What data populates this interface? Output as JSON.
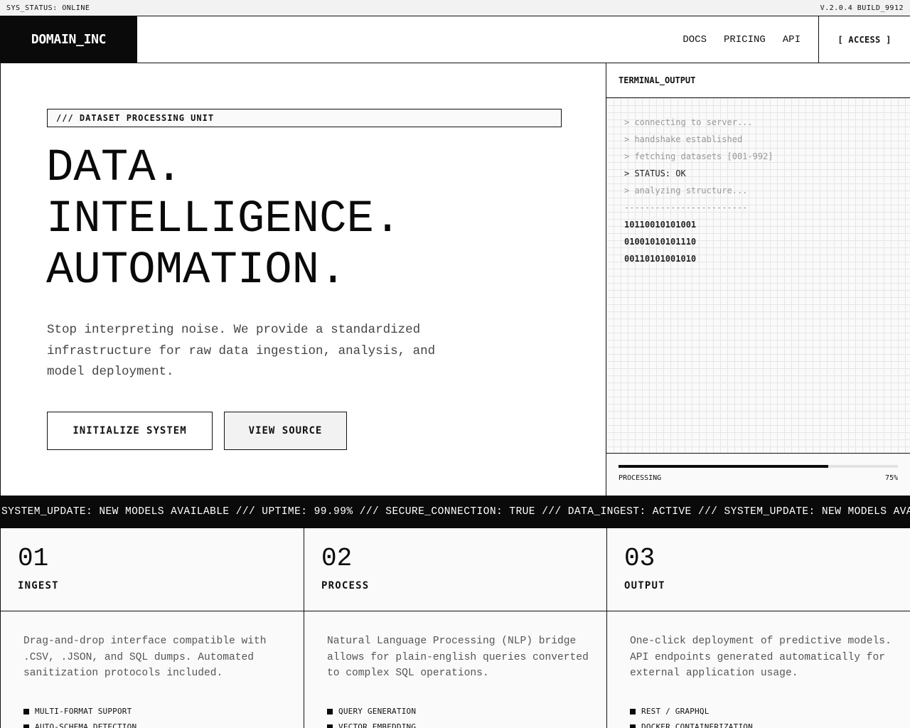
{
  "status_bar": {
    "left": "SYS_STATUS: ONLINE",
    "right": "V.2.0.4 BUILD_9912"
  },
  "header": {
    "logo": "DOMAIN_INC",
    "nav": [
      "DOCS",
      "PRICING",
      "API"
    ],
    "access_label": "[ ACCESS ]"
  },
  "hero": {
    "eyebrow": "/// DATASET PROCESSING UNIT",
    "headline": [
      "DATA.",
      "INTELLIGENCE.",
      "AUTOMATION."
    ],
    "lead": "Stop interpreting noise. We provide a standardized infrastructure for raw data ingestion, analysis, and model deployment.",
    "primary_button": "INITIALIZE SYSTEM",
    "secondary_button": "VIEW SOURCE"
  },
  "terminal": {
    "title": "TERMINAL_OUTPUT",
    "lines": [
      {
        "text": "> connecting to server...",
        "style": "dim"
      },
      {
        "text": "> handshake established",
        "style": "dim"
      },
      {
        "text": "> fetching datasets [001-992]",
        "style": "dim"
      },
      {
        "text": "> STATUS: OK",
        "style": "ok"
      },
      {
        "text": "> analyzing structure...",
        "style": "dim"
      },
      {
        "text": "------------------------",
        "style": "dim"
      },
      {
        "text": "10110010101001",
        "style": "bin"
      },
      {
        "text": "01001010101110",
        "style": "bin"
      },
      {
        "text": "00110101001010",
        "style": "bin"
      }
    ],
    "progress_label": "PROCESSING",
    "progress_percent": 75,
    "progress_text": "75%"
  },
  "ticker": {
    "text": "SYSTEM_UPDATE: NEW MODELS AVAILABLE /// UPTIME: 99.99% /// SECURE_CONNECTION: TRUE /// DATA_INGEST: ACTIVE /// SYSTEM_UPDATE: NEW MODELS AVAILABLE"
  },
  "features": [
    {
      "number": "01",
      "title": "INGEST",
      "description": "Drag-and-drop interface compatible with .CSV, .JSON, and SQL dumps. Automated sanitization protocols included.",
      "bullets": [
        "MULTI-FORMAT SUPPORT",
        "AUTO-SCHEMA DETECTION"
      ]
    },
    {
      "number": "02",
      "title": "PROCESS",
      "description": "Natural Language Processing (NLP) bridge allows for plain-english queries converted to complex SQL operations.",
      "bullets": [
        "QUERY GENERATION",
        "VECTOR EMBEDDING"
      ]
    },
    {
      "number": "03",
      "title": "OUTPUT",
      "description": "One-click deployment of predictive models. API endpoints generated automatically for external application usage.",
      "bullets": [
        "REST / GRAPHQL",
        "DOCKER CONTAINERIZATION"
      ]
    }
  ],
  "colors": {
    "ink": "#0a0a0a",
    "paper": "#fafafa",
    "muted": "#555555",
    "dim": "#999999",
    "grid": "#e6e6e6"
  }
}
